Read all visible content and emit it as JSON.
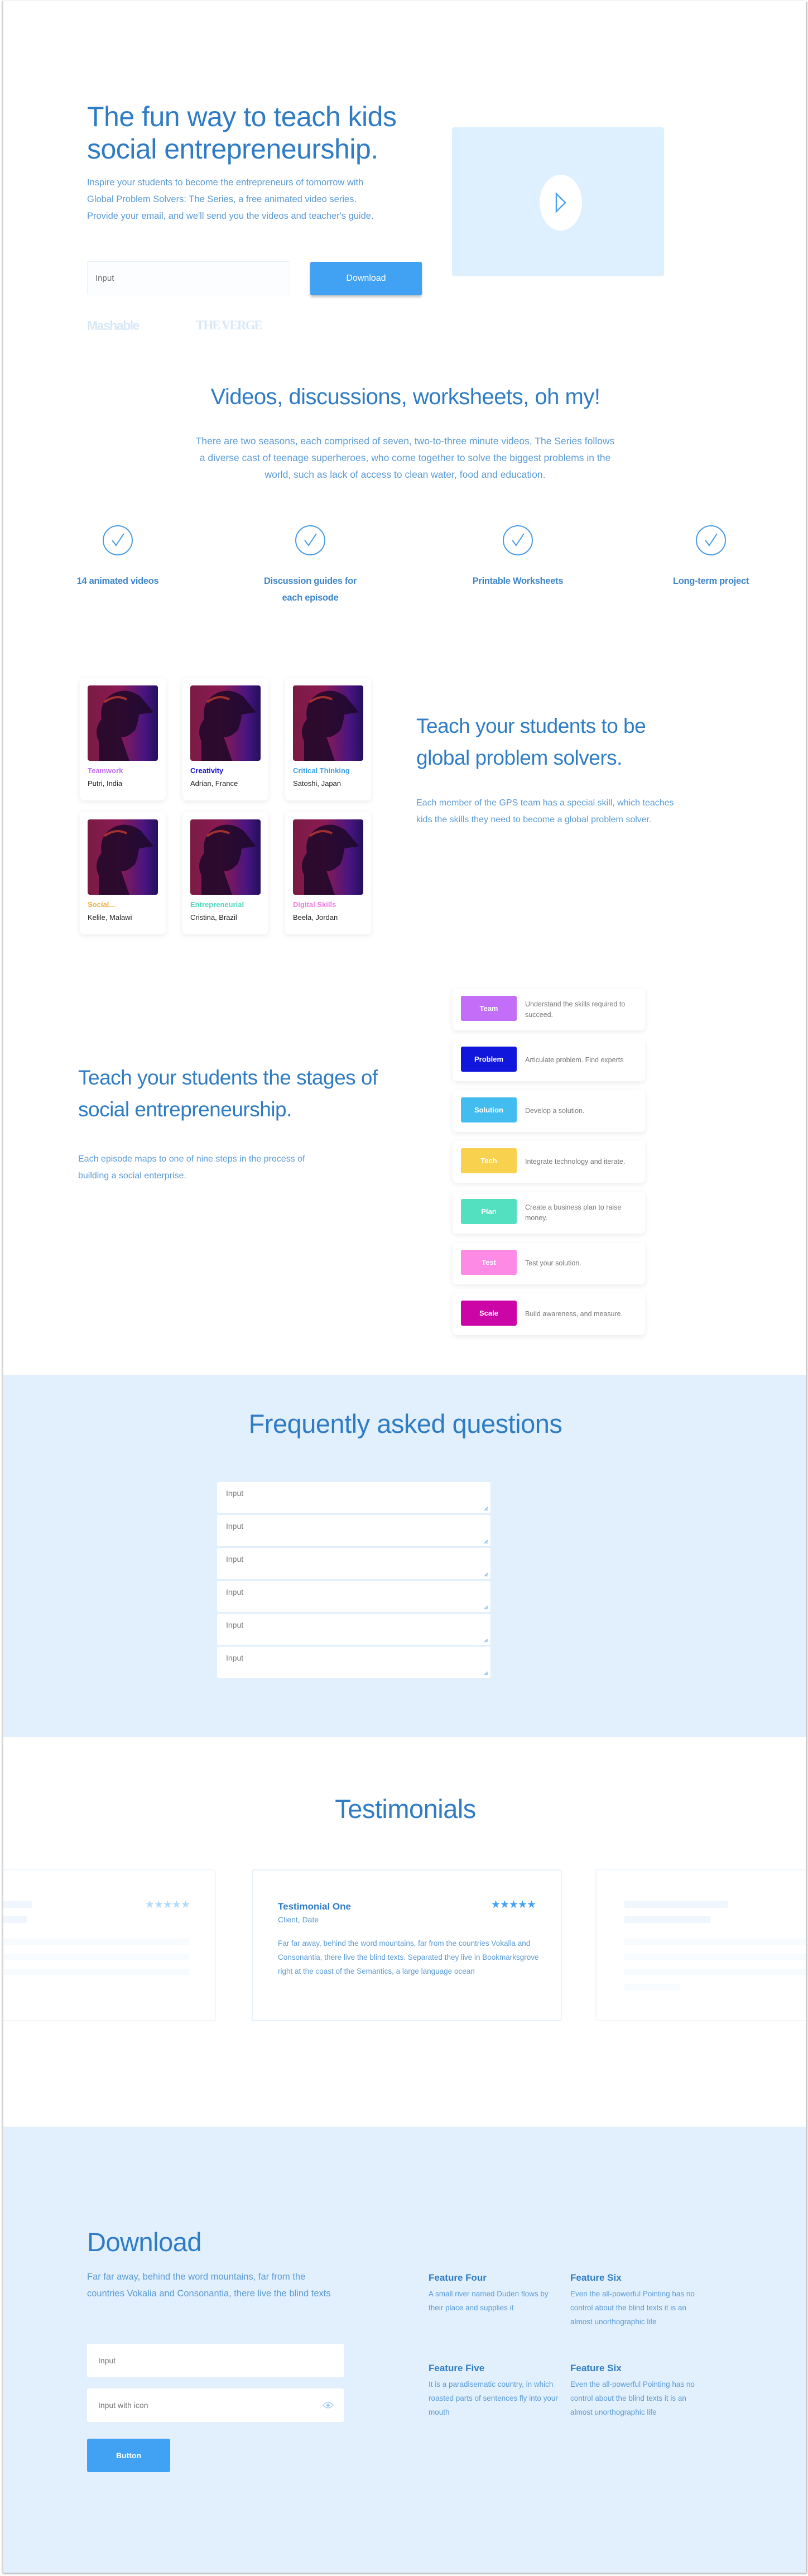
{
  "hero": {
    "title": "The fun way to teach kids social entrepreneurship.",
    "paragraph": "Inspire your students to become the entrepreneurs of tomorrow with Global Problem Solvers: The Series, a free animated video series. Provide your email, and we'll send you the videos and teacher's guide.",
    "email_placeholder": "Input",
    "download_button": "Download",
    "press_logos": [
      "Mashable",
      "THE VERGE"
    ],
    "video_play_icon": "play-icon"
  },
  "overview": {
    "title": "Videos, discussions, worksheets, oh my!",
    "paragraph": "There are two seasons, each comprised of seven, two-to-three minute videos. The Series follows a diverse cast of teenage superheroes, who come together to solve the biggest problems in the world, such as lack of access to clean water, food and education.",
    "features": [
      {
        "icon": "check-circle-icon",
        "label": "14 animated videos"
      },
      {
        "icon": "check-circle-icon",
        "label": "Discussion guides for each episode"
      },
      {
        "icon": "check-circle-icon",
        "label": "Printable Worksheets"
      },
      {
        "icon": "check-circle-icon",
        "label": "Long-term project"
      }
    ]
  },
  "characters": {
    "cards": [
      {
        "skill": "Teamwork",
        "name": "Putri, India",
        "color": "#c36ef4"
      },
      {
        "skill": "Creativity",
        "name": "Adrian, France",
        "color": "#1614d4"
      },
      {
        "skill": "Critical Thinking",
        "name": "Satoshi, Japan",
        "color": "#3da0ea"
      },
      {
        "skill": "Social...",
        "name": "Kelile, Malawi",
        "color": "#f3ae3a"
      },
      {
        "skill": "Entrepreneurial",
        "name": "Cristina, Brazil",
        "color": "#4fd9bd"
      },
      {
        "skill": "Digital Skills",
        "name": "Beela, Jordan",
        "color": "#f57be3"
      }
    ],
    "title": "Teach your students to be global problem solvers.",
    "paragraph": "Each member of the GPS team has a special skill, which teaches kids the skills they need to become a global problem solver."
  },
  "stages": {
    "title": "Teach your students the stages of social entrepreneurship.",
    "paragraph": "Each episode maps to one of nine steps in the process of building a social enterprise.",
    "steps": [
      {
        "tag": "Team",
        "desc": "Understand the skills required to succeed.",
        "color": "#c36ef8"
      },
      {
        "tag": "Problem",
        "desc": "Articulate problem. Find experts",
        "color": "#1116dc"
      },
      {
        "tag": "Solution",
        "desc": "Develop a solution.",
        "color": "#43bcf0"
      },
      {
        "tag": "Tech",
        "desc": "Integrate technology and iterate.",
        "color": "#f8d24f"
      },
      {
        "tag": "Plan",
        "desc": "Create a business plan to raise money.",
        "color": "#52e0c1"
      },
      {
        "tag": "Test",
        "desc": "Test your solution.",
        "color": "#fd8be6"
      },
      {
        "tag": "Scale",
        "desc": "Build awareness, and measure.",
        "color": "#cc05a7"
      }
    ]
  },
  "faq": {
    "title": "Frequently asked questions",
    "inputs": [
      "Input",
      "Input",
      "Input",
      "Input",
      "Input",
      "Input"
    ]
  },
  "testimonials": {
    "title": "Testimonials",
    "featured": {
      "name": "Testimonial One",
      "meta": "Client, Date",
      "body": "Far far away, behind the word mountains, far from the countries Vokalia and Consonantia, there live the blind texts. Separated they live in Bookmarksgrove right at the coast of the Semantics, a large language ocean",
      "rating": 5,
      "stars": "★★★★★"
    },
    "left_stars": "★★★★★"
  },
  "download": {
    "title": "Download",
    "paragraph": "Far far away, behind the word mountains, far from the countries Vokalia and Consonantia, there live the blind texts",
    "input_placeholder": "Input",
    "input_icon_placeholder": "Input with icon",
    "input_icon": "eye-icon",
    "button": "Button",
    "features": [
      {
        "title": "Feature Four",
        "desc": "A small river named Duden flows by their place and supplies it"
      },
      {
        "title": "Feature Six",
        "desc": "Even the all-powerful Pointing has no control about the blind texts it is an almost unorthographic life"
      },
      {
        "title": "Feature Five",
        "desc": "It is a paradisematic country, in which roasted parts of sentences fly into your mouth"
      },
      {
        "title": "Feature Six",
        "desc": "Even the all-powerful Pointing has no control about the blind texts it is an almost unorthographic life"
      }
    ]
  }
}
